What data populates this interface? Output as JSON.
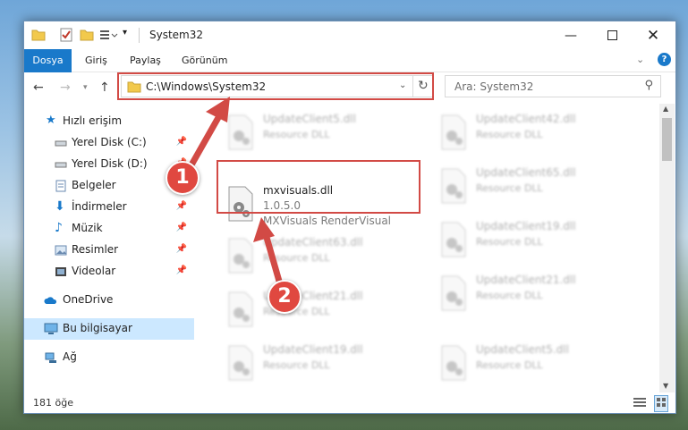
{
  "window": {
    "title": "System32"
  },
  "ribbon": {
    "tabs": [
      "Dosya",
      "Giriş",
      "Paylaş",
      "Görünüm"
    ]
  },
  "address": {
    "path": "C:\\Windows\\System32",
    "search_placeholder": "Ara: System32"
  },
  "sidebar": {
    "quick_access": "Hızlı erişim",
    "items": [
      "Yerel Disk (C:)",
      "Yerel Disk (D:)",
      "Belgeler",
      "İndirmeler",
      "Müzik",
      "Resimler",
      "Videolar"
    ],
    "onedrive": "OneDrive",
    "this_pc": "Bu bilgisayar",
    "network": "Ağ"
  },
  "files": {
    "left": [
      {
        "name": "UpdateClient5.dll",
        "type": "Resource DLL"
      },
      {
        "name": "UpdateClient63.dll",
        "type": "Resource DLL"
      },
      {
        "name": "UpdateClient21.dll",
        "type": "Resource DLL"
      },
      {
        "name": "UpdateClient19.dll",
        "type": "Resource DLL"
      }
    ],
    "right": [
      {
        "name": "UpdateClient42.dll",
        "type": "Resource DLL"
      },
      {
        "name": "UpdateClient65.dll",
        "type": "Resource DLL"
      },
      {
        "name": "UpdateClient19.dll",
        "type": "Resource DLL"
      },
      {
        "name": "UpdateClient21.dll",
        "type": "Resource DLL"
      },
      {
        "name": "UpdateClient5.dll",
        "type": "Resource DLL"
      }
    ],
    "highlight": {
      "name": "mxvisuals.dll",
      "version": "1.0.5.0",
      "description": "MXVisuals RenderVisual"
    }
  },
  "status": {
    "count": "181 öğe"
  },
  "callouts": [
    "1",
    "2"
  ],
  "colors": {
    "accent": "#1979ca",
    "annotation": "#d24a45"
  }
}
